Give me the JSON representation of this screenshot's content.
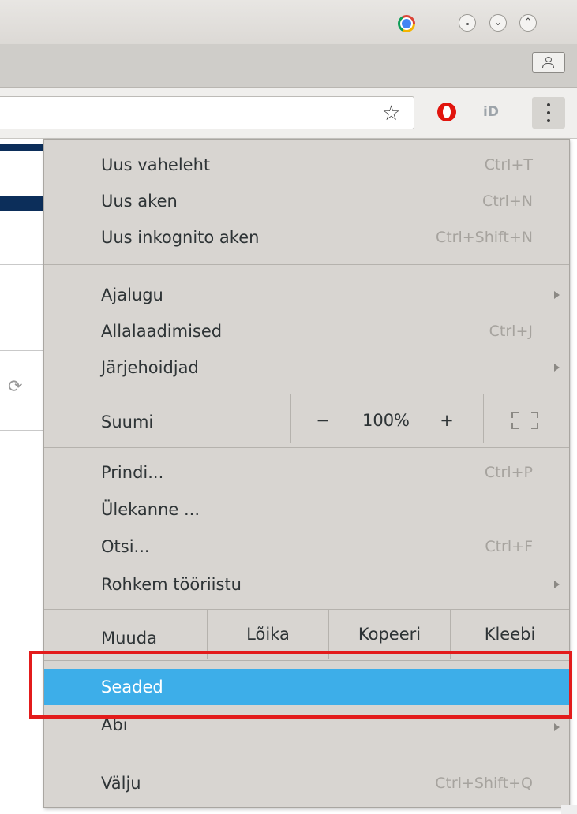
{
  "window": {
    "logo_icon": "chrome-logo-icon",
    "controls": [
      "minimize-icon",
      "maximize-icon",
      "close-icon"
    ],
    "profile_icon": "person-icon"
  },
  "toolbar": {
    "bookmark_icon": "star-icon",
    "extensions": [
      "opera-icon",
      "id-icon"
    ],
    "id_extension_label": "iD",
    "menu_icon": "kebab-menu-icon"
  },
  "menu": {
    "new_tab": {
      "label": "Uus vaheleht",
      "shortcut": "Ctrl+T"
    },
    "new_window": {
      "label": "Uus aken",
      "shortcut": "Ctrl+N"
    },
    "new_incognito": {
      "label": "Uus inkognito aken",
      "shortcut": "Ctrl+Shift+N"
    },
    "history": {
      "label": "Ajalugu"
    },
    "downloads": {
      "label": "Allalaadimised",
      "shortcut": "Ctrl+J"
    },
    "bookmarks": {
      "label": "Järjehoidjad"
    },
    "zoom": {
      "label": "Suumi",
      "minus": "−",
      "value": "100%",
      "plus": "+"
    },
    "print": {
      "label": "Prindi...",
      "shortcut": "Ctrl+P"
    },
    "cast": {
      "label": "Ülekanne ..."
    },
    "find": {
      "label": "Otsi...",
      "shortcut": "Ctrl+F"
    },
    "more_tools": {
      "label": "Rohkem tööriistu"
    },
    "edit": {
      "label": "Muuda",
      "cut": "Lõika",
      "copy": "Kopeeri",
      "paste": "Kleebi"
    },
    "settings": {
      "label": "Seaded"
    },
    "help": {
      "label": "Abi"
    },
    "exit": {
      "label": "Välju",
      "shortcut": "Ctrl+Shift+Q"
    }
  },
  "colors": {
    "highlight": "#3daee9",
    "annotation_box": "#e31b1b",
    "menu_background": "#d8d5d1",
    "shortcut_text": "#a6a39e"
  }
}
